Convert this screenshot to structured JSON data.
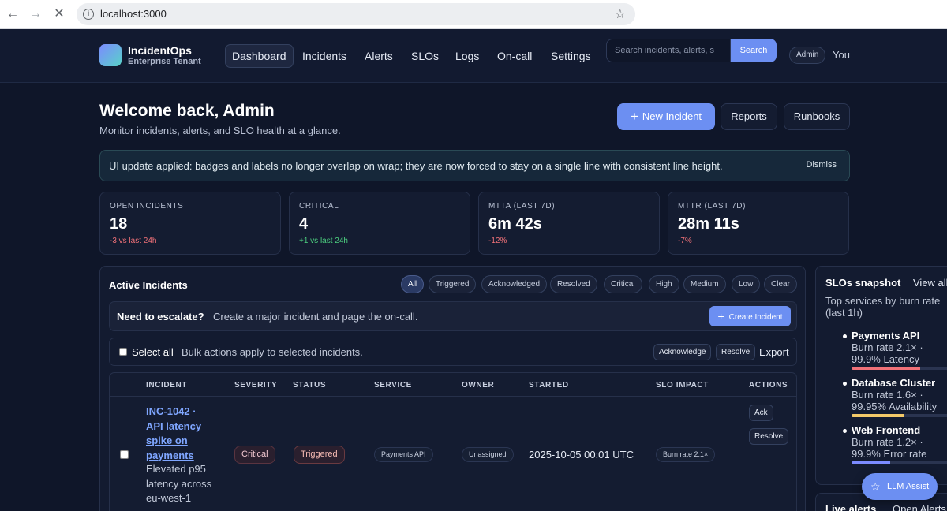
{
  "browser": {
    "url": "localhost:3000"
  },
  "header": {
    "brand_name": "IncidentOps",
    "brand_sub": "Enterprise Tenant",
    "nav": [
      "Dashboard",
      "Incidents",
      "Alerts",
      "SLOs",
      "Logs",
      "On-call",
      "Settings"
    ],
    "active_nav": "Dashboard",
    "search_placeholder": "Search incidents, alerts, s",
    "search_button": "Search",
    "role_badge": "Admin",
    "user": "You"
  },
  "welcome": {
    "title": "Welcome back, Admin",
    "subtitle": "Monitor incidents, alerts, and SLO health at a glance.",
    "new_incident": "New Incident",
    "reports": "Reports",
    "runbooks": "Runbooks"
  },
  "banner": {
    "text": "UI update applied: badges and labels no longer overlap on wrap; they are now forced to stay on a single line with consistent line height.",
    "dismiss": "Dismiss"
  },
  "stats": [
    {
      "label": "OPEN INCIDENTS",
      "value": "18",
      "delta": "-3 vs last 24h",
      "tone": "bad"
    },
    {
      "label": "CRITICAL",
      "value": "4",
      "delta": "+1 vs last 24h",
      "tone": "good"
    },
    {
      "label": "MTTA (LAST 7D)",
      "value": "6m 42s",
      "delta": "-12%",
      "tone": "bad"
    },
    {
      "label": "MTTR (LAST 7D)",
      "value": "28m 11s",
      "delta": "-7%",
      "tone": "bad"
    }
  ],
  "incidents": {
    "title": "Active Incidents",
    "filters": [
      "All",
      "Triggered",
      "Acknowledged",
      "Resolved",
      "Critical",
      "High",
      "Medium",
      "Low",
      "Clear"
    ],
    "active_filter": "All",
    "escalate_title": "Need to escalate?",
    "escalate_text": "Create a major incident and page the on-call.",
    "create_button": "Create Incident",
    "select_all": "Select all",
    "bulk_text": "Bulk actions apply to selected incidents.",
    "bulk_ack": "Acknowledge",
    "bulk_resolve": "Resolve",
    "export": "Export",
    "columns": [
      "INCIDENT",
      "SEVERITY",
      "STATUS",
      "SERVICE",
      "OWNER",
      "STARTED",
      "SLO IMPACT",
      "ACTIONS"
    ],
    "rows": [
      {
        "title": "INC-1042 · API latency spike on payments",
        "description": "Elevated p95 latency across eu-west-1",
        "severity": "Critical",
        "status": "Triggered",
        "service": "Payments API",
        "owner": "Unassigned",
        "started": "2025-10-05 00:01 UTC",
        "slo_impact": "Burn rate 2.1×",
        "actions": [
          "Ack",
          "Resolve"
        ]
      }
    ]
  },
  "slos": {
    "title": "SLOs snapshot",
    "view_all": "View all",
    "subtitle": "Top services by burn rate (last 1h)",
    "items": [
      {
        "name": "Payments API",
        "rate": "Burn rate 2.1× ·",
        "target": "99.9% Latency",
        "color": "#f07178",
        "level": 0.62
      },
      {
        "name": "Database Cluster",
        "rate": "Burn rate 1.6× ·",
        "target": "99.95% Availability",
        "color": "#f3c969",
        "level": 0.48
      },
      {
        "name": "Web Frontend",
        "rate": "Burn rate 1.2× ·",
        "target": "99.9% Error rate",
        "color": "#7c8bff",
        "level": 0.35
      }
    ]
  },
  "live_alerts": {
    "title": "Live alerts",
    "open": "Open Alerts"
  },
  "assist": {
    "label": "LLM Assist"
  },
  "colors": {
    "accent": "#6c8ff2",
    "background": "#0f1629",
    "panel": "#131b30",
    "link": "#7fa6ff"
  }
}
